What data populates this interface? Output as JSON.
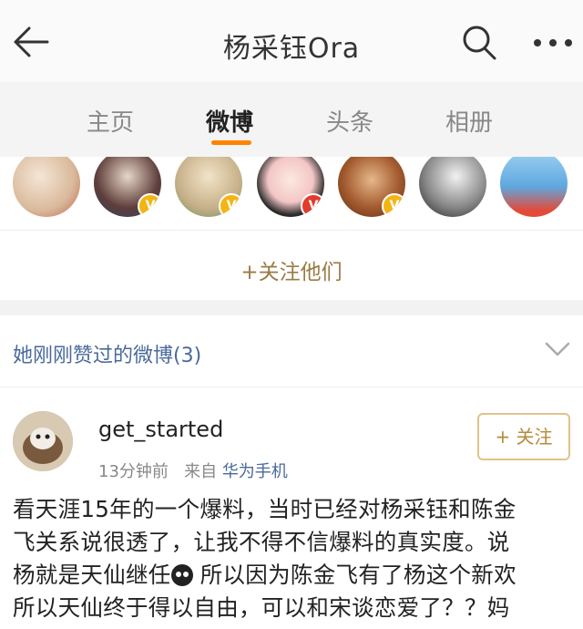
{
  "nav": {
    "title": "杨采钰Ora",
    "back_icon": "back-arrow-icon",
    "search_icon": "search-icon",
    "more_icon": "more-dots-icon"
  },
  "tabs": [
    {
      "label": "主页",
      "active": false
    },
    {
      "label": "微博",
      "active": true
    },
    {
      "label": "头条",
      "active": false
    },
    {
      "label": "相册",
      "active": false
    }
  ],
  "accent_color": "#ff8200",
  "avatars": [
    {
      "badge": ""
    },
    {
      "badge": "V"
    },
    {
      "badge": "V"
    },
    {
      "badge": "V"
    },
    {
      "badge": "V"
    },
    {
      "badge": ""
    },
    {
      "badge": ""
    }
  ],
  "follow_them": {
    "label": "+关注他们"
  },
  "liked_section": {
    "label": "她刚刚赞过的微博(3)"
  },
  "post": {
    "username": "get_started",
    "time": "13分钟前",
    "source_prefix": "来自",
    "source": "华为手机",
    "follow_label": "+ 关注",
    "lines": [
      "看天涯15年的一个爆料，当时已经对杨采钰和陈金",
      "飞关系说很透了，让我不得不信爆料的真实度。说",
      "杨就是天仙继任",
      " 所以因为陈金飞有了杨这个新欢",
      "所以天仙终于得以自由，可以和宋谈恋爱了？？妈"
    ]
  }
}
